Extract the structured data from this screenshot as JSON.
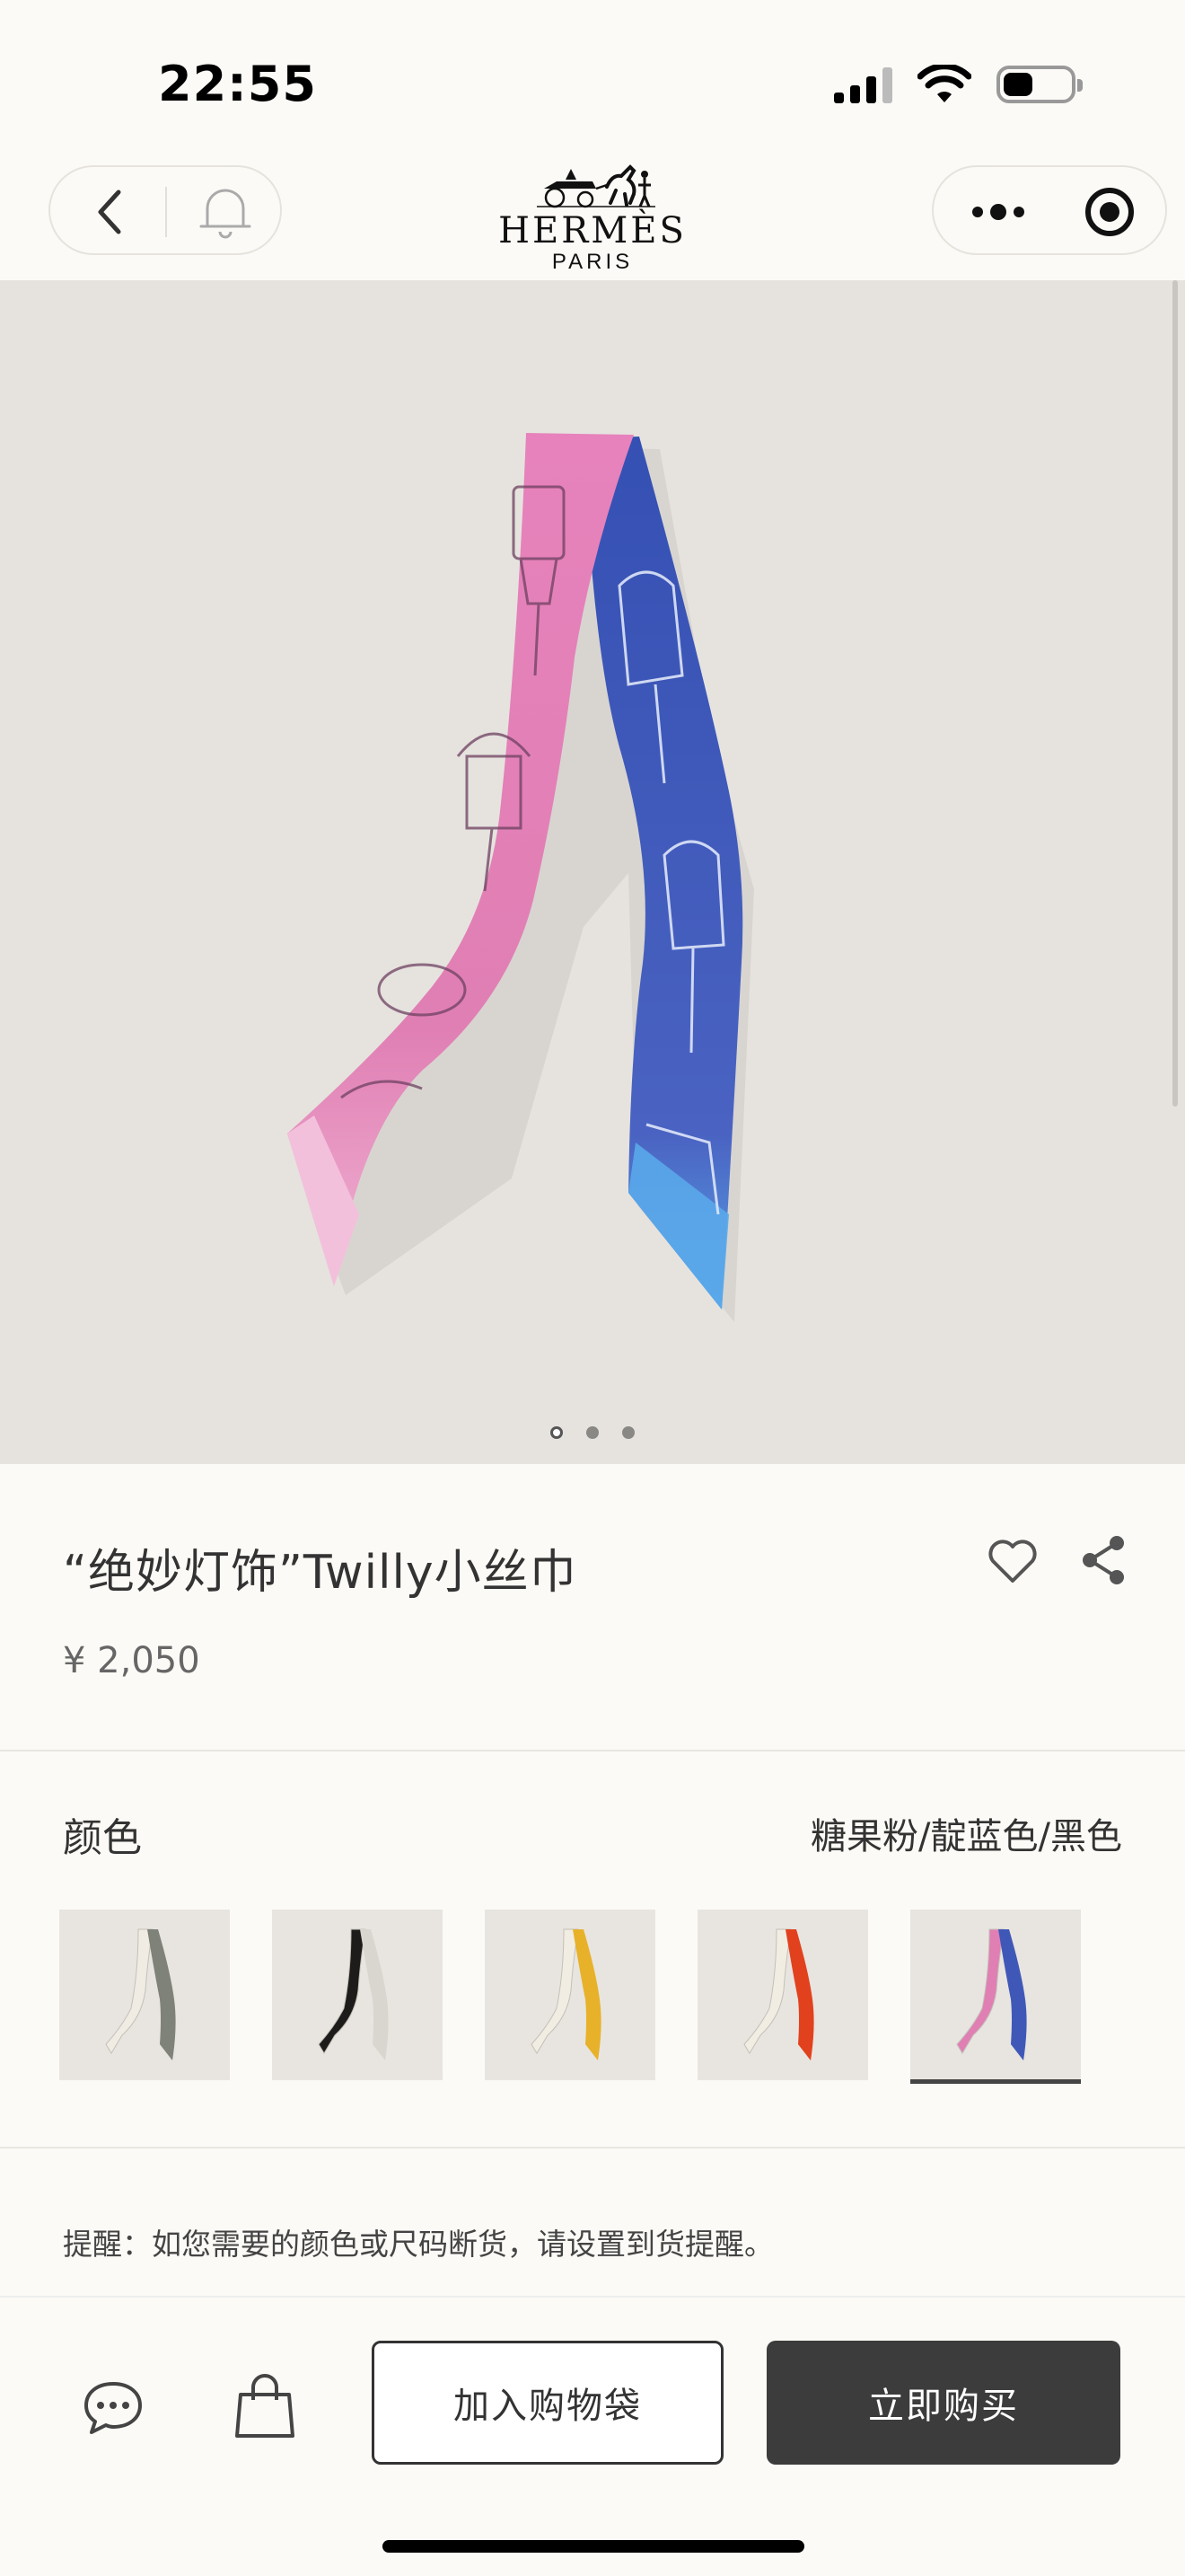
{
  "status_bar": {
    "time": "22:55",
    "signal_icon": "cellular-signal-icon",
    "wifi_icon": "wifi-icon",
    "battery_icon": "battery-icon",
    "battery_level": 0.45
  },
  "nav": {
    "back_icon": "chevron-left-icon",
    "bell_icon": "bell-icon",
    "more_icon": "more-dots-icon",
    "target_icon": "target-icon",
    "brand_name": "HERMÈS",
    "brand_sub": "PARIS"
  },
  "hero": {
    "image": "pink-and-blue-twilly-scarf",
    "dots_total": 3,
    "dots_active_index": 0
  },
  "product": {
    "title": "“绝妙灯饰”Twilly小丝巾",
    "price": "¥ 2,050",
    "like_icon": "heart-outline-icon",
    "share_icon": "share-icon"
  },
  "color": {
    "label": "颜色",
    "selected_value": "糖果粉/靛蓝色/黑色",
    "swatches": [
      {
        "name": "cream-grey",
        "colors": [
          "#f0ece4",
          "#7f8278"
        ],
        "selected": false
      },
      {
        "name": "black-white",
        "colors": [
          "#1d1c1b",
          "#d9d6cf"
        ],
        "selected": false
      },
      {
        "name": "cream-yellow",
        "colors": [
          "#f1ede3",
          "#e7b22a"
        ],
        "selected": false
      },
      {
        "name": "cream-red",
        "colors": [
          "#f1ede3",
          "#e2411e"
        ],
        "selected": false
      },
      {
        "name": "pink-blue",
        "colors": [
          "#e07fb4",
          "#3f58b8"
        ],
        "selected": true
      }
    ]
  },
  "notice": "提醒：如您需要的颜色或尺码断货，请设置到货提醒。",
  "bottom_bar": {
    "chat_icon": "chat-bubble-icon",
    "bag_icon": "shopping-bag-icon",
    "add_to_bag": "加入购物袋",
    "buy_now": "立即购买"
  },
  "colors": {
    "background": "#fcfaf6",
    "hero_background": "#e6e3de",
    "buy_button": "#3c3c3c",
    "pink": "#e07fb4",
    "blue": "#3f58b8"
  }
}
